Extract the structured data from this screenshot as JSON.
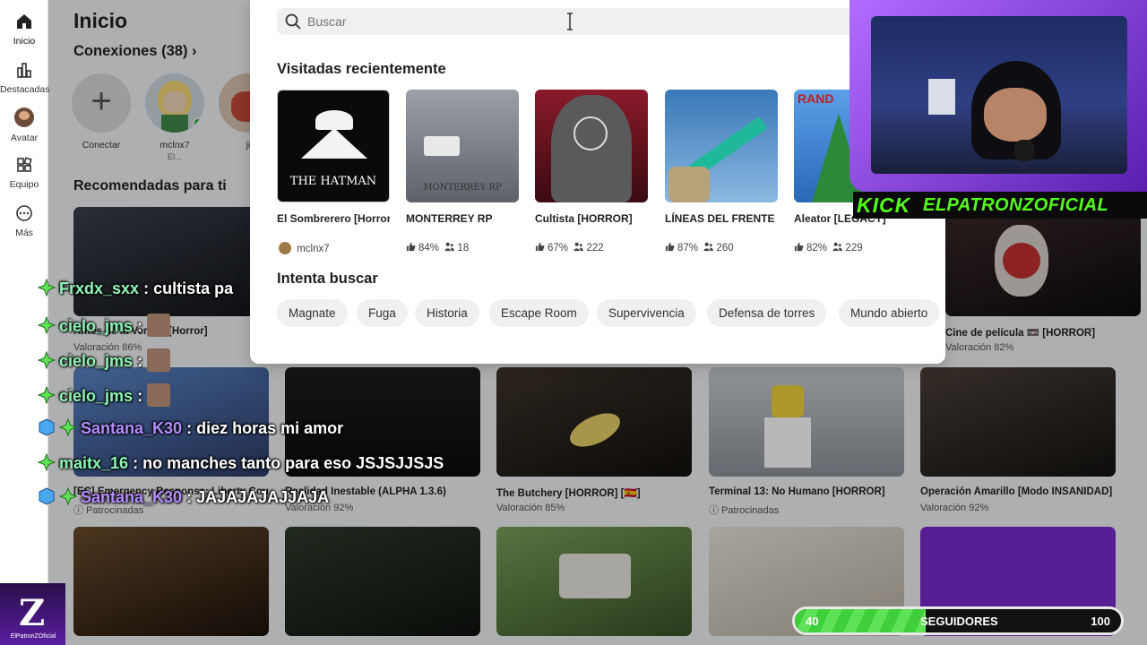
{
  "sidebar": {
    "items": [
      {
        "label": "Inicio",
        "icon": "home-icon"
      },
      {
        "label": "Destacadas",
        "icon": "chart-icon"
      },
      {
        "label": "Avatar",
        "icon": "avatar-icon"
      },
      {
        "label": "Equipo",
        "icon": "inventory-icon"
      },
      {
        "label": "Más",
        "icon": "more-icon"
      }
    ]
  },
  "home": {
    "title": "Inicio",
    "connections_title": "Conexiones (38)",
    "connections": [
      {
        "name": "Conectar",
        "sub": ""
      },
      {
        "name": "mclnx7",
        "sub": "El..."
      },
      {
        "name": "ji",
        "sub": ""
      }
    ],
    "recommended_title": "Recomendadas para ti",
    "row1": [
      {
        "name": "Antes de la Verdad [Horror]",
        "sub": "Valoración 86%"
      },
      {
        "name": "Cine de película 📼 [HORROR]",
        "sub": "Valoración 82%"
      }
    ],
    "row2": [
      {
        "name": "[EC] Emergency Response: Liberty County",
        "sub": "Patrocinadas"
      },
      {
        "name": "Realidad Inestable (ALPHA 1.3.6)",
        "sub": "Valoración 92%"
      },
      {
        "name": "The Butchery [HORROR] [🇪🇸]",
        "sub": "Valoración 85%"
      },
      {
        "name": "Terminal 13: No Humano [HORROR]",
        "sub": "Patrocinadas"
      },
      {
        "name": "Operación Amarillo [Modo INSANIDAD]",
        "sub": "Valoración 92%"
      }
    ]
  },
  "search": {
    "placeholder": "Buscar",
    "recent_title": "Visitadas recientemente",
    "recent": [
      {
        "name": "El Sombrerero [Horror]",
        "creator": "mclnx7",
        "like": "",
        "players": ""
      },
      {
        "name": "MONTERREY RP",
        "like": "84%",
        "players": "18"
      },
      {
        "name": "Cultista [HORROR]",
        "like": "67%",
        "players": "222"
      },
      {
        "name": "LÍNEAS DEL FRENTE",
        "like": "87%",
        "players": "260"
      },
      {
        "name": "Aleator [LEGACY]",
        "like": "82%",
        "players": "229"
      }
    ],
    "thumb_text": {
      "hatman": "THE HATMAN",
      "monterrey": "MONTERREY RP",
      "rand": "RAND"
    },
    "try_title": "Intenta buscar",
    "chips": [
      "Magnate",
      "Fuga",
      "Historia",
      "Escape Room",
      "Supervivencia",
      "Defensa de torres",
      "Mundo abierto"
    ]
  },
  "stream": {
    "kick_logo": "KICK",
    "channel": "ELPATRONZOFICIAL",
    "chat": [
      {
        "user": "Frxdx_sxx",
        "msg": ": cultista pa",
        "color": "green"
      },
      {
        "user": "cielo_jms",
        "msg": ":",
        "color": "green"
      },
      {
        "user": "cielo_jms",
        "msg": ":",
        "color": "green"
      },
      {
        "user": "cielo_jms",
        "msg": ":",
        "color": "green"
      },
      {
        "user": "Santana_K30",
        "msg": ": diez horas mi amor",
        "color": "purple"
      },
      {
        "user": "maitx_16",
        "msg": ": no manches tanto para eso JSJSJJSJS",
        "color": "green"
      },
      {
        "user": "Santana_K30",
        "msg": ": JAJAJAJAJJAJA",
        "color": "purple"
      }
    ],
    "follower_goal": {
      "start": "40",
      "label": "SEGUIDORES",
      "end": "100",
      "progress_percent": 40
    },
    "brand": {
      "letter": "Z",
      "name": "ElPatronZOficial"
    }
  },
  "colors": {
    "kick_green": "#53fc18",
    "chat_green": "#8cf5b6",
    "chat_purple": "#b58cff",
    "cam_purple": "#9a4dff"
  }
}
